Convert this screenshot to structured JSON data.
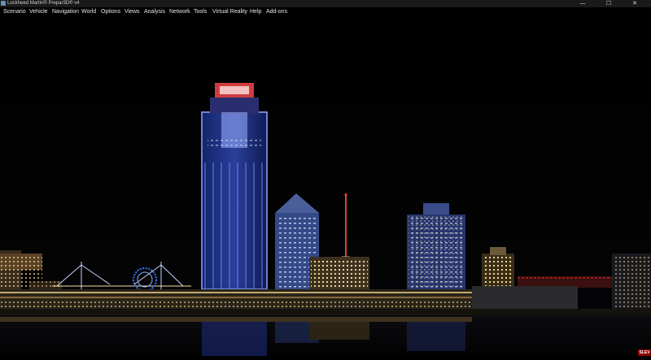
{
  "window": {
    "title": "Lockheed Martin® Prepar3D® v4",
    "minimize_glyph": "—",
    "maximize_glyph": "☐",
    "close_glyph": "✕"
  },
  "menu": {
    "items": [
      "Scenario",
      "Vehicle",
      "Navigation",
      "World",
      "Options",
      "Views",
      "Analysis",
      "Network",
      "Tools",
      "Virtual Reality",
      "Help",
      "Add-ons"
    ]
  },
  "badge": {
    "text": "SLEV"
  },
  "colors": {
    "titlebar_bg": "#1a1a1a",
    "menubar_bg": "#000000",
    "tower_blue": "#3a5ad8",
    "tower_red": "#e8494f",
    "window_light": "#f4d89a"
  }
}
